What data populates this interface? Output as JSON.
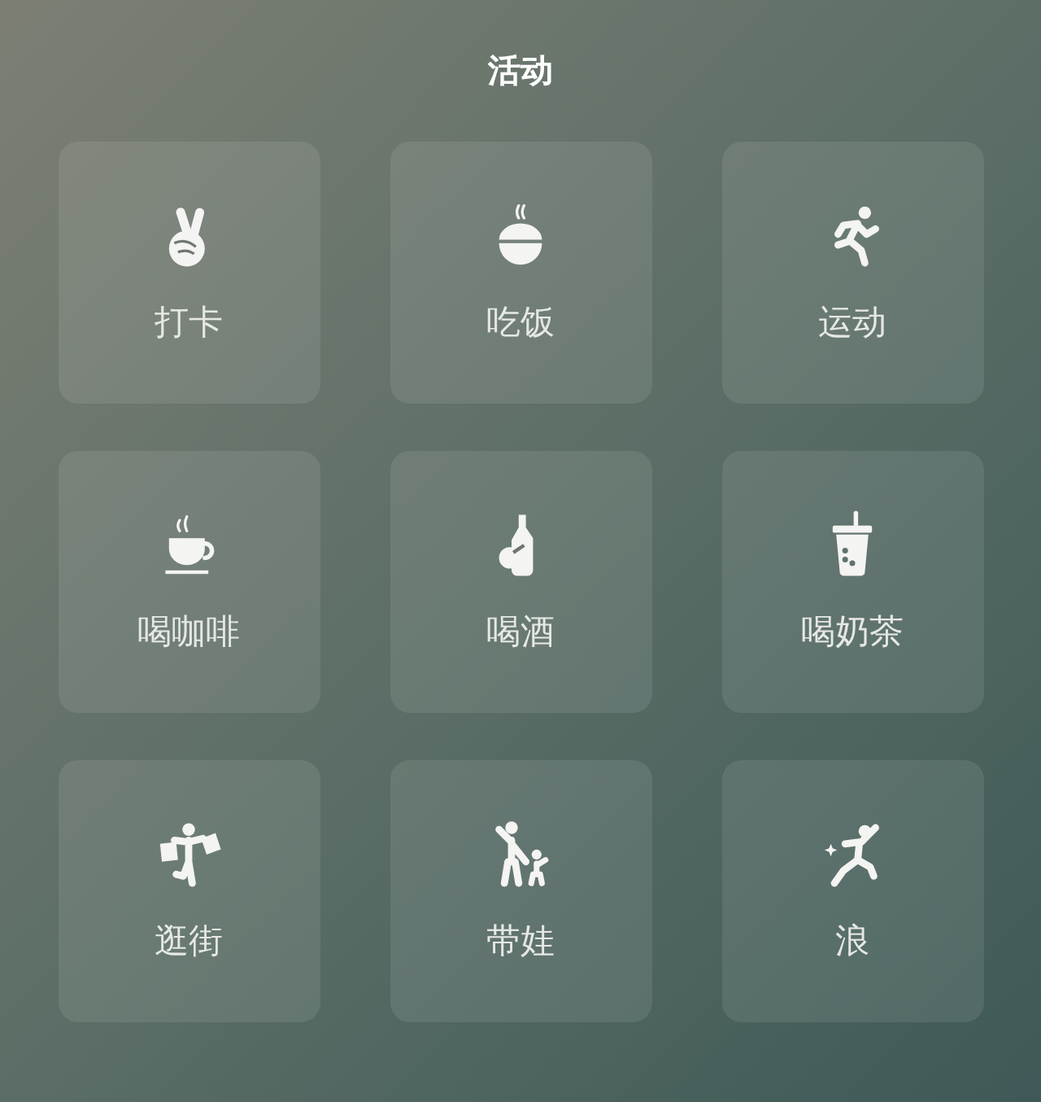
{
  "title": "活动",
  "tiles": [
    {
      "label": "打卡",
      "kind": "victory"
    },
    {
      "label": "吃饭",
      "kind": "bowl"
    },
    {
      "label": "运动",
      "kind": "runner"
    },
    {
      "label": "喝咖啡",
      "kind": "coffee"
    },
    {
      "label": "喝酒",
      "kind": "bottle"
    },
    {
      "label": "喝奶茶",
      "kind": "bubbletea"
    },
    {
      "label": "逛街",
      "kind": "shopper"
    },
    {
      "label": "带娃",
      "kind": "parent"
    },
    {
      "label": "浪",
      "kind": "dancer"
    }
  ]
}
